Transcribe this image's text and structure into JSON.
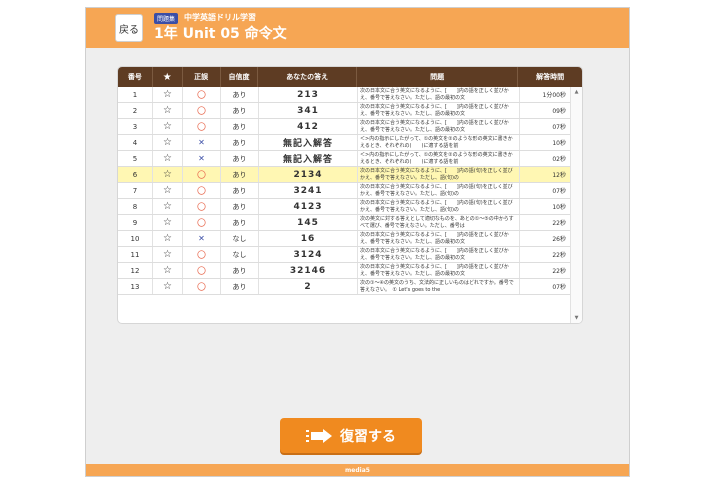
{
  "header": {
    "back_label": "戻る",
    "badge": "問題集",
    "subtitle": "中学英語ドリル学習",
    "title": "1年 Unit 05 命令文"
  },
  "table": {
    "columns": [
      "番号",
      "★",
      "正誤",
      "自信度",
      "あなたの答え",
      "問題",
      "解答時間"
    ],
    "rows": [
      {
        "no": "1",
        "star": "☆",
        "result": "o",
        "confidence": "あり",
        "answer": "213",
        "question": "次の日本文に合う英文になるように、[　　]内の語を正しく並びかえ、番号で答えなさい。ただし、語の最初の文",
        "time": "1分00秒"
      },
      {
        "no": "2",
        "star": "☆",
        "result": "o",
        "confidence": "あり",
        "answer": "341",
        "question": "次の日本文に合う英文になるように、[　　]内の語を正しく並びかえ、番号で答えなさい。ただし、語の最初の文",
        "time": "09秒"
      },
      {
        "no": "3",
        "star": "☆",
        "result": "o",
        "confidence": "あり",
        "answer": "412",
        "question": "次の日本文に合う英文になるように、[　　]内の語を正しく並びかえ、番号で答えなさい。ただし、語の最初の文",
        "time": "07秒"
      },
      {
        "no": "4",
        "star": "☆",
        "result": "x",
        "confidence": "あり",
        "answer": "無記入解答",
        "question": "＜>内の指示にしたがって、①の英文を②のような形の英文に書きかえるとき、それぞれの(　　)に適する語を前",
        "time": "10秒"
      },
      {
        "no": "5",
        "star": "☆",
        "result": "x",
        "confidence": "あり",
        "answer": "無記入解答",
        "question": "＜>内の指示にしたがって、①の英文を②のような形の英文に書きかえるとき、それぞれの(　　)に適する語を前",
        "time": "02秒"
      },
      {
        "no": "6",
        "star": "☆",
        "result": "o",
        "confidence": "あり",
        "answer": "2134",
        "question": "次の日本文に合う英文になるように、[　　]内の語(句)を正しく並びかえ、番号で答えなさい。ただし、語(句)の",
        "time": "12秒"
      },
      {
        "no": "7",
        "star": "☆",
        "result": "o",
        "confidence": "あり",
        "answer": "3241",
        "question": "次の日本文に合う英文になるように、[　　]内の語(句)を正しく並びかえ、番号で答えなさい。ただし、語(句)の",
        "time": "07秒"
      },
      {
        "no": "8",
        "star": "☆",
        "result": "o",
        "confidence": "あり",
        "answer": "4123",
        "question": "次の日本文に合う英文になるように、[　　]内の語(句)を正しく並びかえ、番号で答えなさい。ただし、語(句)の",
        "time": "10秒"
      },
      {
        "no": "9",
        "star": "☆",
        "result": "o",
        "confidence": "あり",
        "answer": "145",
        "question": "次の英文に対する答えとして適切なものを、あとの①～⑤の中からすべて選び、番号で答えなさい。ただし、番号は",
        "time": "22秒"
      },
      {
        "no": "10",
        "star": "☆",
        "result": "x",
        "confidence": "なし",
        "answer": "16",
        "question": "次の日本文に合う英文になるように、[　　]内の語を正しく並びかえ、番号で答えなさい。ただし、語の最初の文",
        "time": "26秒"
      },
      {
        "no": "11",
        "star": "☆",
        "result": "o",
        "confidence": "なし",
        "answer": "3124",
        "question": "次の日本文に合う英文になるように、[　　]内の語を正しく並びかえ、番号で答えなさい。ただし、語の最初の文",
        "time": "22秒"
      },
      {
        "no": "12",
        "star": "☆",
        "result": "o",
        "confidence": "あり",
        "answer": "32146",
        "question": "次の日本文に合う英文になるように、[　　]内の語を正しく並びかえ、番号で答えなさい。ただし、語の最初の文",
        "time": "22秒"
      },
      {
        "no": "13",
        "star": "☆",
        "result": "o",
        "confidence": "あり",
        "answer": "2",
        "question": "次の①～④の英文のうち、文法的に正しいものはどれですか。番号で答えなさい。　① Let's goes to the",
        "time": "07秒"
      }
    ]
  },
  "review_button": "復習する",
  "footer": {
    "logo": "media5"
  },
  "colors": {
    "header": "#f6a654",
    "table_head": "#5e3c23",
    "button": "#f08a1f",
    "highlight_row": "#fff7b3",
    "correct": "#e8694f",
    "wrong": "#3b4ea6"
  }
}
